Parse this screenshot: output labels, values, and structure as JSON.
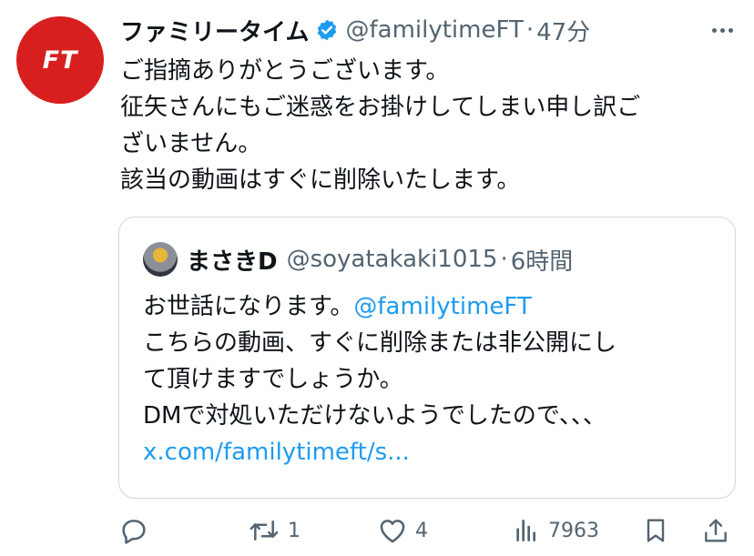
{
  "tweet": {
    "avatar_text": "FT",
    "display_name": "ファミリータイム",
    "handle": "@familytimeFT",
    "separator": "·",
    "time": "47分",
    "text_lines": [
      "ご指摘ありがとうございます。",
      "征矢さんにもご迷惑をお掛けしてしまい申し訳ご",
      "ざいません。",
      "該当の動画はすぐに削除いたします。"
    ]
  },
  "quote": {
    "display_name": "まさきD",
    "handle": "@soyatakaki1015",
    "separator": "·",
    "time": "6時間",
    "line1_prefix": "お世話になります。",
    "line1_mention": "@familytimeFT",
    "text_lines": [
      "こちらの動画、すぐに削除または非公開にし",
      "て頂けますでしょうか。",
      "DMで対処いただけないようでしたので、、、"
    ],
    "link": "x.com/familytimeft/s..."
  },
  "actions": {
    "reply_count": "",
    "retweet_count": "1",
    "like_count": "4",
    "views_count": "7963"
  },
  "colors": {
    "brand_red": "#d81f1f",
    "verified_blue": "#1d9bf0",
    "muted_gray": "#536471",
    "link_blue": "#1d9bf0"
  },
  "icons": [
    "verified-badge-icon",
    "more-icon",
    "reply-icon",
    "retweet-icon",
    "like-icon",
    "views-icon",
    "bookmark-icon",
    "share-icon"
  ]
}
